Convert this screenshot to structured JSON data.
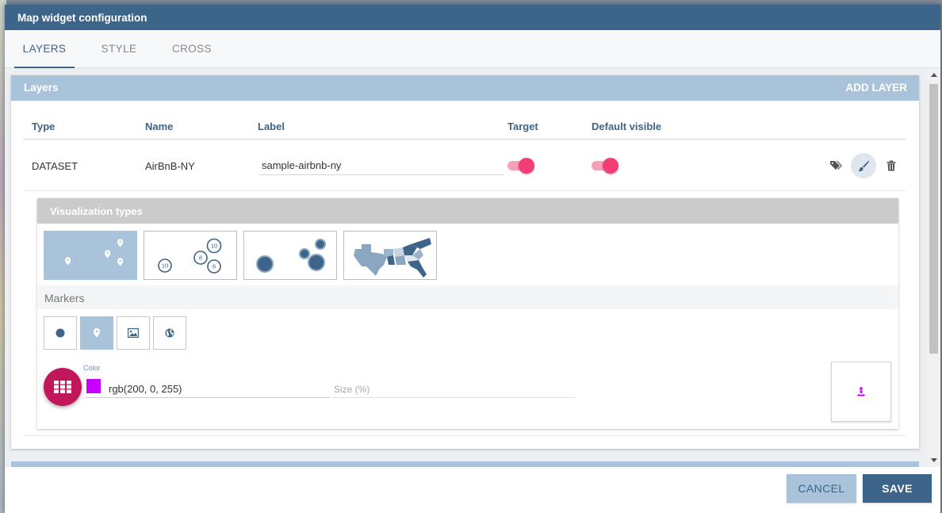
{
  "dialog": {
    "title": "Map widget configuration"
  },
  "tabs": [
    {
      "label": "LAYERS",
      "active": true
    },
    {
      "label": "STYLE",
      "active": false
    },
    {
      "label": "CROSS",
      "active": false
    }
  ],
  "layers_card": {
    "title": "Layers",
    "add_label": "ADD LAYER",
    "columns": [
      "Type",
      "Name",
      "Label",
      "Target",
      "Default visible"
    ],
    "rows": [
      {
        "type": "DATASET",
        "name": "AirBnB-NY",
        "label": "sample-airbnb-ny",
        "target": true,
        "default_visible": true,
        "actions": [
          "tag-icon",
          "brush-icon",
          "trash-icon"
        ]
      }
    ]
  },
  "visualization": {
    "title": "Visualization types",
    "options": [
      {
        "name": "markers",
        "selected": true
      },
      {
        "name": "clusters",
        "selected": false,
        "cluster_counts": [
          "10",
          "8",
          "6",
          "10"
        ]
      },
      {
        "name": "bubbles",
        "selected": false
      },
      {
        "name": "choropleth",
        "selected": false
      }
    ],
    "markers_label": "Markers",
    "marker_types": [
      {
        "name": "dot-icon",
        "selected": false
      },
      {
        "name": "pin-icon",
        "selected": true
      },
      {
        "name": "image-icon",
        "selected": false
      },
      {
        "name": "globe-icon",
        "selected": false
      }
    ],
    "color_label": "Color",
    "color_value": "rgb(200, 0, 255)",
    "size_placeholder": "Size (%)"
  },
  "footer": {
    "cancel_label": "CANCEL",
    "save_label": "SAVE"
  },
  "colors": {
    "primary": "#3d6489",
    "header_light": "#a9c3da",
    "toggle_pink": "#f33d75",
    "fab": "#c2185b",
    "marker_color": "#c800ff"
  }
}
